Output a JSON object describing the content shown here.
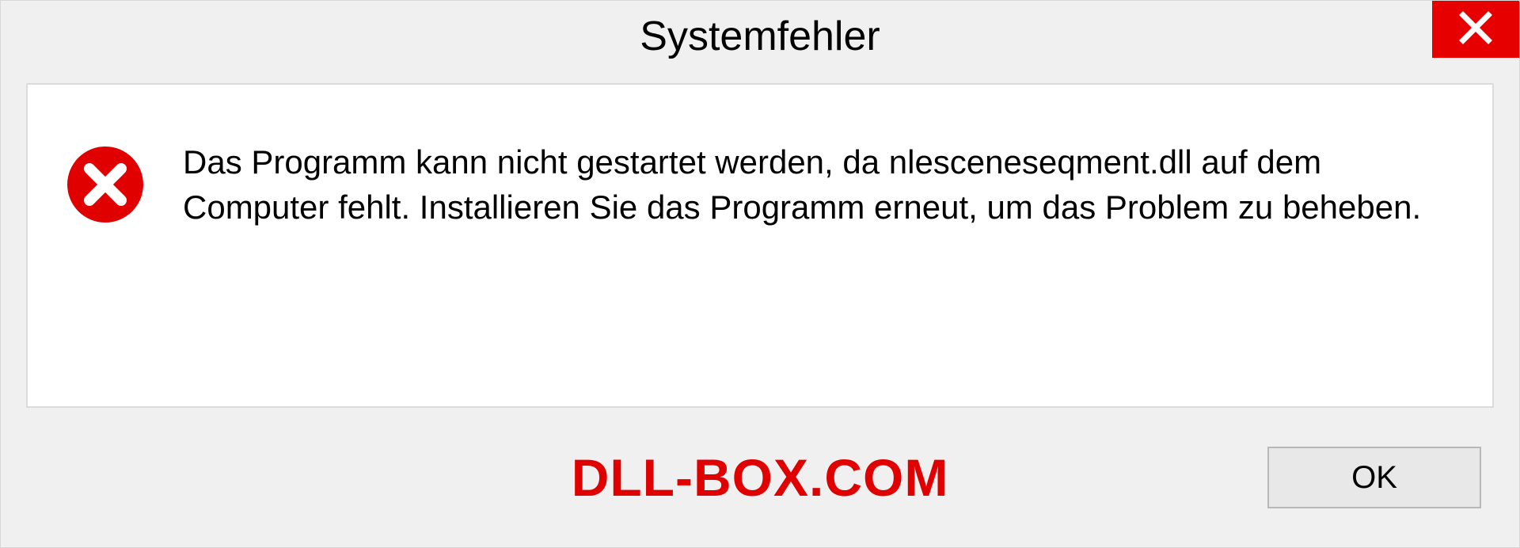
{
  "dialog": {
    "title": "Systemfehler",
    "message": "Das Programm kann nicht gestartet werden, da nlesceneseqment.dll auf dem Computer fehlt. Installieren Sie das Programm erneut, um das Problem zu beheben.",
    "ok_label": "OK"
  },
  "watermark": "DLL-BOX.COM",
  "colors": {
    "close_bg": "#e60000",
    "error_icon": "#e10000",
    "watermark": "#e10000",
    "panel_border": "#dcdcdc",
    "dialog_bg": "#f0f0f0"
  },
  "icons": {
    "close": "close-icon",
    "error": "error-circle-x-icon"
  }
}
